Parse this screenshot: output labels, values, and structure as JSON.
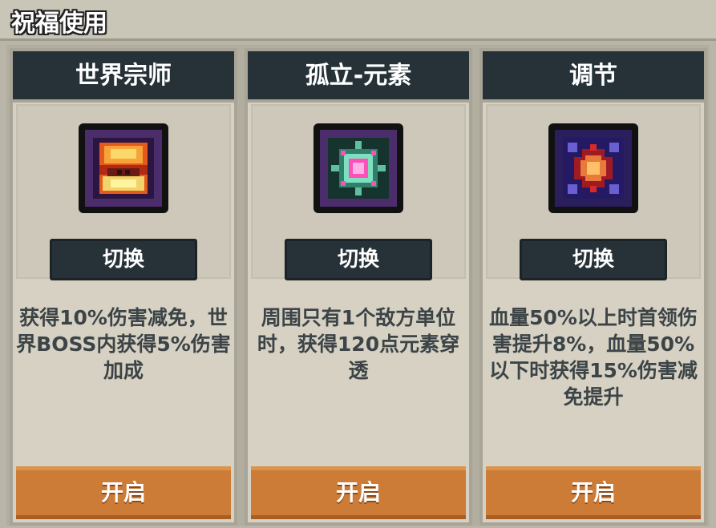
{
  "header": {
    "title": "祝福使用"
  },
  "cards": [
    {
      "name": "世界宗师",
      "switch_label": "切换",
      "description": "获得10%伤害减免，世界BOSS内获得5%伤害加成",
      "open_label": "开启",
      "icon": "world-master-blessing-icon"
    },
    {
      "name": "孤立-元素",
      "switch_label": "切换",
      "description": "周围只有1个敌方单位时，获得120点元素穿透",
      "open_label": "开启",
      "icon": "isolated-element-blessing-icon"
    },
    {
      "name": "调节",
      "switch_label": "切换",
      "description": "血量50%以上时首领伤害提升8%，血量50%以下时获得15%伤害减免提升",
      "open_label": "开启",
      "icon": "adjust-blessing-icon"
    }
  ],
  "colors": {
    "header_dark": "#263238",
    "accent_orange": "#cd7c37",
    "card_bg": "#d6d1c2"
  }
}
